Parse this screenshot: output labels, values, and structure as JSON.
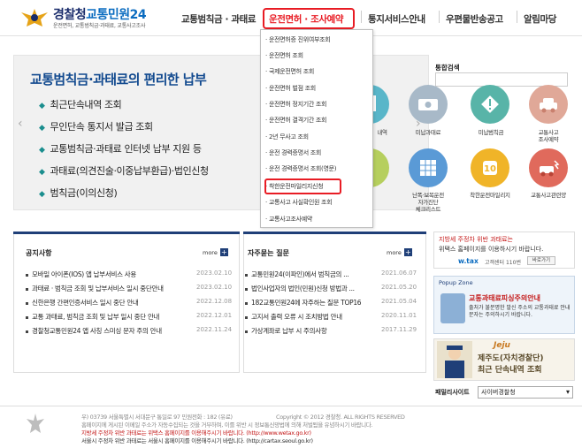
{
  "header": {
    "logo_title_a": "경찰청",
    "logo_title_b": "교통민원24",
    "logo_subtitle": "운전면허, 교통범칙금·과태료, 교통사고조사",
    "nav": [
      "교통범칙금 · 과태료",
      "운전면허 · 조사예약",
      "통지서비스안내",
      "우편물반송공고",
      "알림마당"
    ]
  },
  "dropdown": {
    "items": [
      "운전면허증 진위여부조회",
      "운전면허 조회",
      "국제운전면허 조회",
      "운전면허 벌점 조회",
      "운전면허 정지기간 조회",
      "운전면허 결격기간 조회",
      "2년 무사고 조회",
      "운전 경력증명서 조회",
      "운전 경력증명서 조회(영문)",
      "착한운전마일리지신청",
      "교통사고 사실확인원 조회",
      "교통사고조사예약"
    ]
  },
  "hero": {
    "title": "교통범칙금·과태료의 편리한 납부",
    "items": [
      "최근단속내역 조회",
      "무인단속 통지서 발급 조회",
      "교통범칙금·과태료 인터넷 납부 지원 등",
      "과태료(의견진술·이중납부환급)·법인신청",
      "범칙금(이의신청)"
    ],
    "prev_arrow": "‹",
    "next_arrow": "›"
  },
  "search": {
    "label": "통합검색"
  },
  "icon_grid": {
    "row1": [
      {
        "label": "내역",
        "icon": "document-icon",
        "color": "#59b6c9"
      },
      {
        "label": "미납과태료",
        "icon": "money-icon",
        "color": "#a8b9c8"
      },
      {
        "label": "미납범칙금",
        "icon": "warning-icon",
        "color": "#58b4a8"
      },
      {
        "label": "교통사고\n조사예약",
        "icon": "car-crash-icon",
        "color": "#e0a898"
      }
    ],
    "row2": [
      {
        "label": "",
        "icon": "map-icon",
        "color": "#b6cf5e"
      },
      {
        "label": "난폭·보복운전\n자가진단\n체크리스트",
        "icon": "checklist-icon",
        "color": "#5a9ad6"
      },
      {
        "label": "착한운전마일리지",
        "icon": "mileage-icon",
        "color": "#f0b428"
      },
      {
        "label": "교통사고관련양",
        "icon": "accident-icon",
        "color": "#e06a5c"
      }
    ]
  },
  "notice": {
    "title": "공지사항",
    "more": "more",
    "rows": [
      {
        "text": "모바일 아이폰(IOS) 앱 납부서비스 사용",
        "date": "2023.02.10"
      },
      {
        "text": "과태료 · 범칙금 조회 및 납부서비스 일시 중단안내",
        "date": "2023.02.10"
      },
      {
        "text": "신한은행 간편인증서비스 일시 중단 안내",
        "date": "2022.12.08"
      },
      {
        "text": "교통 과태료, 범칙금 조회 및 납부 일시 중단 안내",
        "date": "2022.12.01"
      },
      {
        "text": "경찰청교통민원24 앱 사칭 스미싱 문자 주의 안내",
        "date": "2022.11.24"
      }
    ]
  },
  "faq": {
    "title": "자주묻는 질문",
    "more": "more",
    "rows": [
      {
        "text": "교통민원24(이파인)에서 범칙금의 ...",
        "date": "2021.06.07"
      },
      {
        "text": "법인사업자의 법인(민원)신청 방법과 ...",
        "date": "2021.05.20"
      },
      {
        "text": "182교통민원24에 자주하는 질문 TOP16",
        "date": "2021.05.04"
      },
      {
        "text": "고지서 출력 오류 시 조치방법 안내",
        "date": "2020.11.01"
      },
      {
        "text": "가상계좌로 납부 시 주의사항",
        "date": "2017.11.29"
      }
    ]
  },
  "banner1": {
    "line1": "지방세 주정차 위반 과태료는",
    "line2": "위택스 홈페이지를 이용하시기 바랍니다.",
    "brand": "w.tax",
    "phone": "고객센터 110번",
    "button": "바로가기"
  },
  "popup": {
    "title": "Popup Zone",
    "headline": "교통과태료피싱주의안내",
    "body": "출처가 불분명한 발신 주소의 교통과태료 안내 문자는 주의하시기 바랍니다."
  },
  "banner3": {
    "brand": "Jeju",
    "line1": "제주도(자치경찰단)",
    "line2": "최근 단속내역 조회"
  },
  "family_site": {
    "label": "패밀리사이트",
    "selected": "사이버경찰청"
  },
  "footer": {
    "address": "우) 03739 서울특별시 서대문구 통일로 97   민원전화 : 182 (유료)",
    "copyright": "Copyright © 2012 경찰청. ALL RIGHTS RESERVED",
    "line2": "홈페이지에 게시된 이메일 주소가 자동수집되는 것을 거부하며, 이를 위반 시 정보통신망법에 의해 처벌됨을 유념하시기 바랍니다.",
    "line3": "지방세 주정차 위반 과태료는 위택스 홈페이지를 이용해주시기 바랍니다. (http://www.wetax.go.kr)",
    "line4": "서울시 주정차 위반 과태료는 서울시 홈페이지를 이용해주시기 바랍니다. (http://cartax.seoul.go.kr)"
  }
}
